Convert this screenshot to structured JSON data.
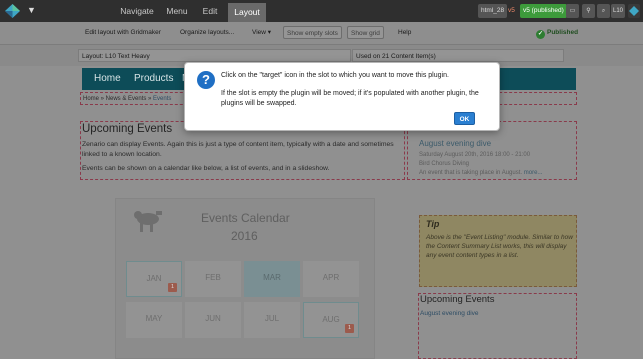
{
  "admin_bar": {
    "tabs": [
      "Navigate",
      "Menu",
      "Edit",
      "Layout"
    ],
    "active_tab": "Layout",
    "version_name": "html_28",
    "version_id": "v5",
    "version_status": "v5 (published)",
    "icon_preview": "link",
    "l10_label": "L10"
  },
  "toolbar": {
    "edit_gridmaker": "Edit layout with Gridmaker",
    "organize_layouts": "Organize layouts...",
    "view": "View ▾",
    "show_empty_slots": "Show empty slots",
    "show_grid": "Show grid",
    "help": "Help",
    "published": "Published"
  },
  "info_row": {
    "layout": "Layout: L10 Text Heavy",
    "used_on": "Used on 21 Content Item(s)"
  },
  "site": {
    "nav": [
      "Home",
      "Products",
      "M"
    ],
    "breadcrumb": "Home » News & Events » ",
    "breadcrumb_current": "Events",
    "main_title": "Upcoming Events",
    "main_p1": "Zenario can display Events. Again this is just a type of content item, typically with a date and sometimes linked to a known location.",
    "main_p2": "Events can be shown on a calendar like below, a list of events, and in a slideshow.",
    "side_title1": "August evening dive",
    "side_date": "Saturday August 20th, 2016 18:00 - 21:00",
    "side_venue": "Bird Chorus Diving",
    "side_desc": "An event that is taking place in August.",
    "side_more": "more..."
  },
  "calendar": {
    "title": "Events Calendar",
    "year": "2016",
    "months": [
      {
        "name": "JAN",
        "count": "1",
        "has_events": true,
        "highlight": false
      },
      {
        "name": "FEB",
        "count": "",
        "has_events": false,
        "highlight": false
      },
      {
        "name": "MAR",
        "count": "",
        "has_events": false,
        "highlight": true
      },
      {
        "name": "APR",
        "count": "",
        "has_events": false,
        "highlight": false
      },
      {
        "name": "MAY",
        "count": "",
        "has_events": false,
        "highlight": false
      },
      {
        "name": "JUN",
        "count": "",
        "has_events": false,
        "highlight": false
      },
      {
        "name": "JUL",
        "count": "",
        "has_events": false,
        "highlight": false
      },
      {
        "name": "AUG",
        "count": "1",
        "has_events": true,
        "highlight": false
      }
    ]
  },
  "tip": {
    "title": "Tip",
    "text": "Above is the \"Event Listing\" module. Similar to how the Content Summary List works, this will display any event content types in a list."
  },
  "side2": {
    "title": "Upcoming Events",
    "link": "August evening dive"
  },
  "dialog": {
    "message1": "Click on the \"target\" icon in the slot to which you want to move this plugin.",
    "message2": "If the slot is empty the plugin will be moved; if it's populated with another plugin, the plugins will be swapped.",
    "ok": "OK"
  },
  "colors": {
    "accent": "#2a7fd1",
    "published": "#3d9b3b",
    "nav": "#0d4c58"
  }
}
